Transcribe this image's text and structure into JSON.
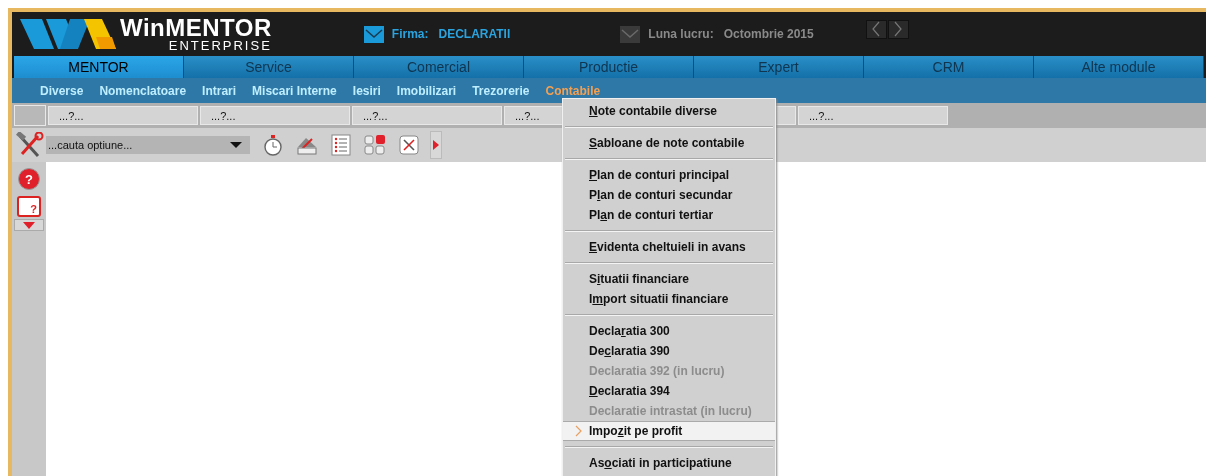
{
  "header": {
    "logo_title": "WinMENTOR",
    "logo_subtitle": "ENTERPRISE",
    "firma": {
      "checked": true,
      "label": "Firma:",
      "value": "DECLARATII"
    },
    "luna": {
      "checked": false,
      "label": "Luna lucru:",
      "value": "Octombrie 2015"
    }
  },
  "tabs": [
    {
      "label": "MENTOR",
      "selected": true
    },
    {
      "label": "Service",
      "selected": false
    },
    {
      "label": "Comercial",
      "selected": false
    },
    {
      "label": "Productie",
      "selected": false
    },
    {
      "label": "Expert",
      "selected": false
    },
    {
      "label": "CRM",
      "selected": false
    },
    {
      "label": "Alte module",
      "selected": false
    }
  ],
  "submenu": [
    {
      "label": "Diverse",
      "selected": false
    },
    {
      "label": "Nomenclatoare",
      "selected": false
    },
    {
      "label": "Intrari",
      "selected": false
    },
    {
      "label": "Miscari Interne",
      "selected": false
    },
    {
      "label": "Iesiri",
      "selected": false
    },
    {
      "label": "Imobilizari",
      "selected": false
    },
    {
      "label": "Trezorerie",
      "selected": false
    },
    {
      "label": "Contabile",
      "selected": true
    }
  ],
  "slots": [
    "...?...",
    "...?...",
    "...?...",
    "...?...",
    "...?..."
  ],
  "search": {
    "placeholder": "...cauta optiune..."
  },
  "side_icons": {
    "help_mark": "?",
    "feedback_mark": "?"
  },
  "dropdown_menu": [
    {
      "kind": "item",
      "key": "N",
      "post": "ote contabile diverse",
      "disabled": false,
      "selected": false
    },
    {
      "kind": "separator"
    },
    {
      "kind": "item",
      "key": "S",
      "post": "abloane de note contabile",
      "disabled": false,
      "selected": false
    },
    {
      "kind": "separator"
    },
    {
      "kind": "item",
      "key": "P",
      "post": "lan de conturi principal",
      "disabled": false,
      "selected": false
    },
    {
      "kind": "item",
      "pre": "P",
      "key": "l",
      "post": "an de conturi secundar",
      "disabled": false,
      "selected": false
    },
    {
      "kind": "item",
      "pre": "Pl",
      "key": "a",
      "post": "n de conturi tertiar",
      "disabled": false,
      "selected": false
    },
    {
      "kind": "separator"
    },
    {
      "kind": "item",
      "key": "E",
      "post": "videnta cheltuieli in avans",
      "disabled": false,
      "selected": false
    },
    {
      "kind": "separator"
    },
    {
      "kind": "item",
      "pre": "S",
      "key": "i",
      "post": "tuatii financiare",
      "disabled": false,
      "selected": false
    },
    {
      "kind": "item",
      "pre": "I",
      "key": "m",
      "post": "port situatii financiare",
      "disabled": false,
      "selected": false
    },
    {
      "kind": "separator"
    },
    {
      "kind": "item",
      "pre": "Decla",
      "key": "r",
      "post": "atia 300",
      "disabled": false,
      "selected": false
    },
    {
      "kind": "item",
      "pre": "De",
      "key": "c",
      "post": "laratia 390",
      "disabled": false,
      "selected": false
    },
    {
      "kind": "item",
      "pre": "Declaratia 392 (in lucru)",
      "disabled": true,
      "selected": false
    },
    {
      "kind": "item",
      "key": "D",
      "post": "eclaratia 394",
      "disabled": false,
      "selected": false
    },
    {
      "kind": "item",
      "pre": "Declaratie intrastat (in lucru)",
      "disabled": true,
      "selected": false
    },
    {
      "kind": "item",
      "pre": "Impo",
      "key": "z",
      "post": "it pe profit",
      "disabled": false,
      "selected": true
    },
    {
      "kind": "separator"
    },
    {
      "kind": "item",
      "pre": "As",
      "key": "o",
      "post": "ciati in participatiune",
      "disabled": false,
      "selected": false
    }
  ]
}
